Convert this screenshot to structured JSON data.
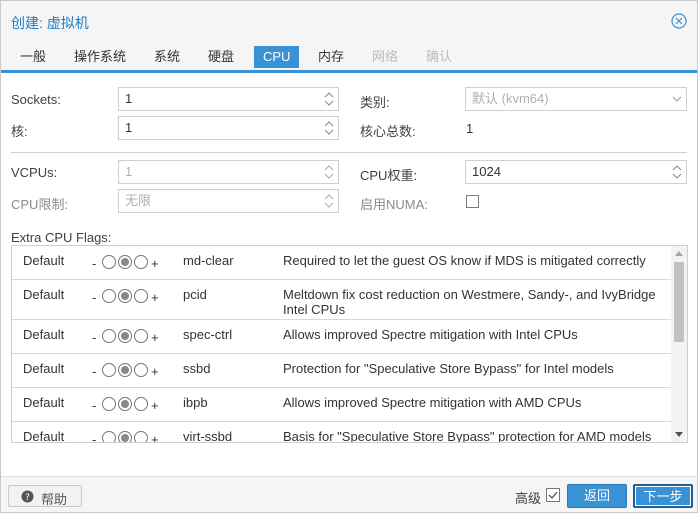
{
  "window": {
    "title": "创建: 虚拟机"
  },
  "tabs": [
    {
      "label": "一般",
      "state": "normal"
    },
    {
      "label": "操作系统",
      "state": "normal"
    },
    {
      "label": "系统",
      "state": "normal"
    },
    {
      "label": "硬盘",
      "state": "normal"
    },
    {
      "label": "CPU",
      "state": "active"
    },
    {
      "label": "内存",
      "state": "normal"
    },
    {
      "label": "网络",
      "state": "disabled"
    },
    {
      "label": "确认",
      "state": "disabled"
    }
  ],
  "form": {
    "sockets": {
      "label": "Sockets:",
      "value": "1"
    },
    "cores": {
      "label": "核:",
      "value": "1"
    },
    "type": {
      "label": "类别:",
      "value": "默认 (kvm64)"
    },
    "total_cores": {
      "label": "核心总数:",
      "value": "1"
    },
    "vcpus": {
      "label": "VCPUs:",
      "value": "1"
    },
    "cpu_limit": {
      "label": "CPU限制:",
      "value": "无限"
    },
    "cpu_weight": {
      "label": "CPU权重:",
      "value": "1024"
    },
    "numa": {
      "label": "启用NUMA:",
      "checked": false
    }
  },
  "flags": {
    "label": "Extra CPU Flags:",
    "rows": [
      {
        "state": "Default",
        "minus": "-",
        "plus": "+",
        "name": "md-clear",
        "desc": "Required to let the guest OS know if MDS is mitigated correctly"
      },
      {
        "state": "Default",
        "minus": "-",
        "plus": "+",
        "name": "pcid",
        "desc": "Meltdown fix cost reduction on Westmere, Sandy-, and IvyBridge",
        "desc2": "Intel CPUs"
      },
      {
        "state": "Default",
        "minus": "-",
        "plus": "+",
        "name": "spec-ctrl",
        "desc": "Allows improved Spectre mitigation with Intel CPUs"
      },
      {
        "state": "Default",
        "minus": "-",
        "plus": "+",
        "name": "ssbd",
        "desc": "Protection for \"Speculative Store Bypass\" for Intel models"
      },
      {
        "state": "Default",
        "minus": "-",
        "plus": "+",
        "name": "ibpb",
        "desc": "Allows improved Spectre mitigation with AMD CPUs"
      },
      {
        "state": "Default",
        "minus": "-",
        "plus": "+",
        "name": "virt-ssbd",
        "desc": "Basis for \"Speculative Store Bypass\" protection for AMD models"
      }
    ]
  },
  "footer": {
    "help": "帮助",
    "advanced": "高级",
    "advanced_checked": true,
    "back": "返回",
    "next": "下一步"
  },
  "colors": {
    "accent": "#3892d4",
    "title": "#157fcc"
  },
  "icons": {
    "close": "close-circle-icon",
    "help": "question-circle-icon",
    "spinner": "spinner-arrows-icon",
    "dropdown": "chevron-down-icon"
  }
}
